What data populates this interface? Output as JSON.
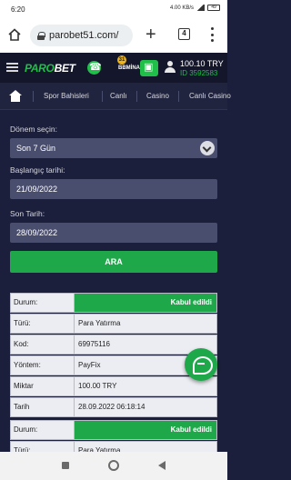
{
  "status_bar": {
    "time": "6:20",
    "net_speed": "4.00 KB/s",
    "battery": "49"
  },
  "browser": {
    "url": "parobet51.com/",
    "tab_count": "4"
  },
  "header": {
    "logo_part1": "PARO",
    "logo_part2": "BET",
    "promo_label": "BBMİNA",
    "promo_badge": "31",
    "balance": "100.10 TRY",
    "user_id": "ID 3592583"
  },
  "nav": {
    "items": [
      "Spor Bahisleri",
      "Canlı",
      "Casino",
      "Canlı Casino"
    ]
  },
  "form": {
    "period_label": "Dönem seçin:",
    "period_value": "Son 7 Gün",
    "start_label": "Başlangıç tarihi:",
    "start_value": "21/09/2022",
    "end_label": "Son Tarih:",
    "end_value": "28/09/2022",
    "search_button": "ARA"
  },
  "transactions": [
    {
      "rows": [
        {
          "key": "Durum:",
          "value": "Kabul edildi"
        },
        {
          "key": "Türü:",
          "value": "Para Yatırma"
        },
        {
          "key": "Kod:",
          "value": "69975116"
        },
        {
          "key": "Yöntem:",
          "value": "PayFix"
        },
        {
          "key": "Miktar",
          "value": "100.00 TRY"
        },
        {
          "key": "Tarih",
          "value": "28.09.2022 06:18:14"
        }
      ]
    },
    {
      "rows": [
        {
          "key": "Durum:",
          "value": "Kabul edildi"
        },
        {
          "key": "Türü:",
          "value": "Para Yatırma"
        }
      ]
    }
  ],
  "colors": {
    "accent_green": "#1fa84a",
    "page_bg": "#1c1f3b",
    "field_bg": "#4a4e6e"
  }
}
